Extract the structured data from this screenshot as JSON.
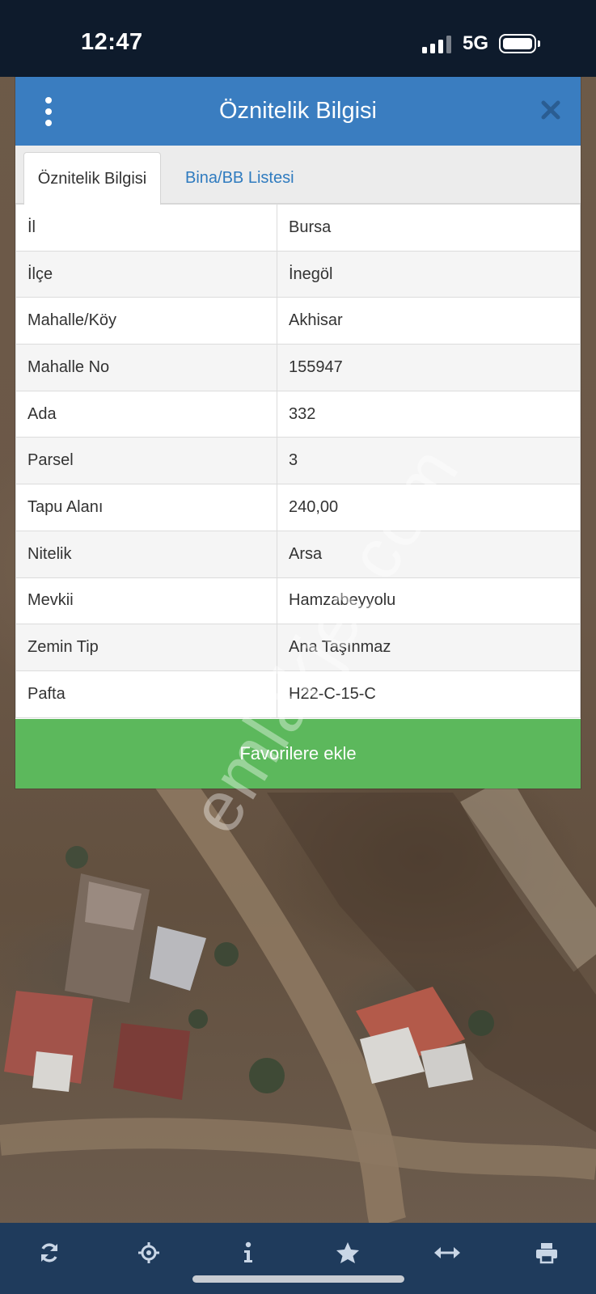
{
  "status_bar": {
    "time": "12:47",
    "network": "5G"
  },
  "dialog": {
    "title": "Öznitelik Bilgisi",
    "tabs": [
      {
        "label": "Öznitelik Bilgisi",
        "active": true
      },
      {
        "label": "Bina/BB Listesi",
        "active": false
      }
    ],
    "rows": [
      {
        "key": "İl",
        "value": "Bursa"
      },
      {
        "key": "İlçe",
        "value": "İnegöl"
      },
      {
        "key": "Mahalle/Köy",
        "value": "Akhisar"
      },
      {
        "key": "Mahalle No",
        "value": "155947"
      },
      {
        "key": "Ada",
        "value": "332"
      },
      {
        "key": "Parsel",
        "value": "3"
      },
      {
        "key": "Tapu Alanı",
        "value": "240,00"
      },
      {
        "key": "Nitelik",
        "value": "Arsa"
      },
      {
        "key": "Mevkii",
        "value": "Hamzabeyyolu"
      },
      {
        "key": "Zemin Tip",
        "value": "Ana Taşınmaz"
      },
      {
        "key": "Pafta",
        "value": "H22-C-15-C"
      }
    ],
    "favorite_button": "Favorilere ekle"
  },
  "watermark": "emlakjet.com",
  "toolbar": {
    "icons": [
      "refresh-icon",
      "locate-icon",
      "info-icon",
      "star-icon",
      "measure-icon",
      "print-icon"
    ]
  },
  "colors": {
    "header": "#3a7dc0",
    "favorite_button": "#5cb85c",
    "toolbar": "#1f3b5c",
    "status_bar": "#0e1b2c"
  }
}
